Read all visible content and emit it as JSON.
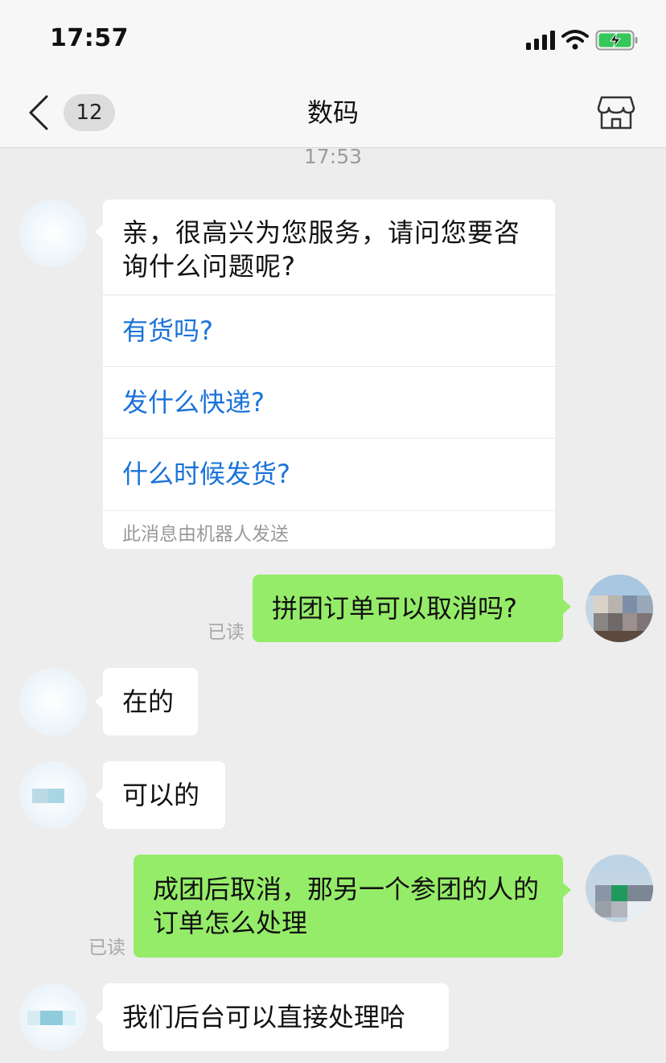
{
  "status_bar": {
    "time": "17:57"
  },
  "nav": {
    "unread_count": "12",
    "title": "数码"
  },
  "chat": {
    "timestamp": "17:53",
    "robot_card": {
      "text": "亲，很高兴为您服务，请问您要咨询什么问题呢?",
      "options": [
        "有货吗?",
        "发什么快递?",
        "什么时候发货?"
      ],
      "footer": "此消息由机器人发送"
    },
    "messages": [
      {
        "side": "right",
        "text": "拼团订单可以取消吗?",
        "status": "已读"
      },
      {
        "side": "left",
        "text": "在的"
      },
      {
        "side": "left",
        "text": "可以的"
      },
      {
        "side": "right",
        "text": "成团后取消，那另一个参团的人的订单怎么处理",
        "status": "已读"
      },
      {
        "side": "left",
        "text": "我们后台可以直接处理哈"
      }
    ]
  },
  "colors": {
    "outgoing_bubble": "#95ec69",
    "incoming_bubble": "#ffffff",
    "link_blue": "#1a73d9",
    "chat_background": "#ededed"
  },
  "icons": {
    "back": "chevron-left-icon",
    "store": "store-icon",
    "signal": "signal-icon",
    "wifi": "wifi-icon",
    "battery": "battery-charging-icon"
  }
}
